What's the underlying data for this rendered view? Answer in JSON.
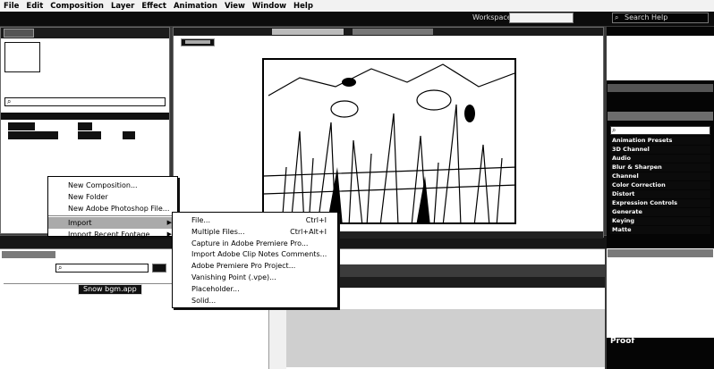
{
  "menubar": {
    "items": [
      "File",
      "Edit",
      "Composition",
      "Layer",
      "Effect",
      "Animation",
      "View",
      "Window",
      "Help"
    ]
  },
  "toolbar": {
    "workspace_label": "Workspace:",
    "search_placeholder": "Search Help"
  },
  "effects": {
    "items": [
      "Animation Presets",
      "3D Channel",
      "Audio",
      "Blur & Sharpen",
      "Channel",
      "Color Correction",
      "Distort",
      "Expression Controls",
      "Generate",
      "Keying",
      "Matte"
    ]
  },
  "context_menu": {
    "items": [
      {
        "label": "New Composition..."
      },
      {
        "label": "New Folder"
      },
      {
        "label": "New Adobe Photoshop File..."
      },
      {
        "label": "Import",
        "submenu": true
      },
      {
        "label": "Import Recent Footage",
        "submenu": true
      }
    ],
    "import_submenu": [
      {
        "label": "File...",
        "shortcut": "Ctrl+I"
      },
      {
        "label": "Multiple Files...",
        "shortcut": "Ctrl+Alt+I"
      },
      {
        "label": "Capture in Adobe Premiere Pro..."
      },
      {
        "label": "Import Adobe Clip Notes Comments..."
      },
      {
        "label": "Adobe Premiere Pro Project..."
      },
      {
        "label": "Vanishing Point (.vpe)..."
      },
      {
        "label": "Placeholder..."
      },
      {
        "label": "Solid..."
      }
    ]
  },
  "timeline": {
    "layer_name": "Snow bgm.app"
  },
  "lower_right": {
    "text": "Proof"
  }
}
